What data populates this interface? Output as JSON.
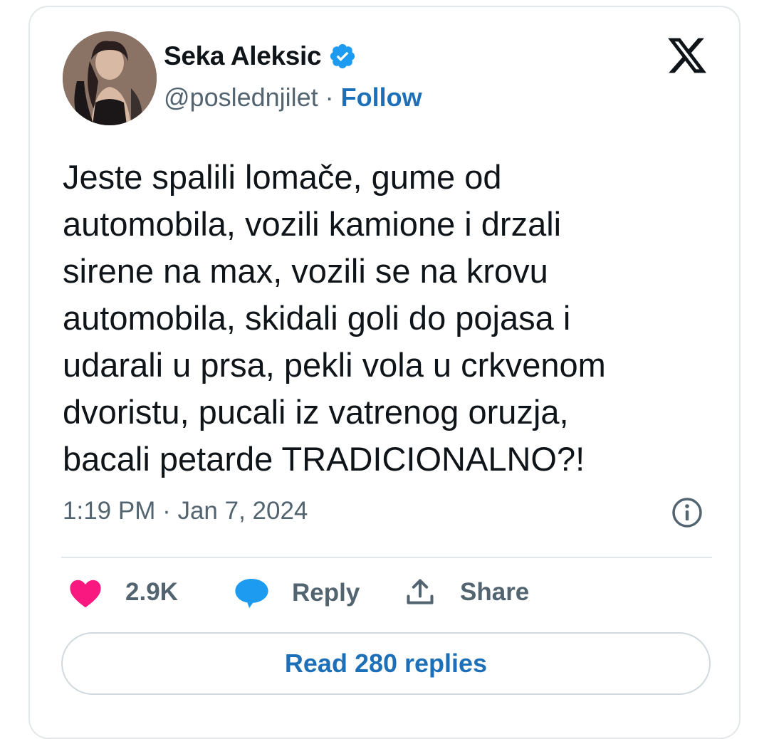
{
  "author": {
    "name": "Seka Aleksic",
    "handle": "@poslednjilet",
    "separator": "·",
    "follow_label": "Follow",
    "verified": true
  },
  "tweet": {
    "text": "Jeste spalili lomače, gume od\nautomobila, vozili kamione i drzali\nsirene na max, vozili se na krovu\nautomobila, skidali goli do pojasa i\nudarali u prsa, pekli vola u crkvenom\ndvoristu, pucali iz vatrenog oruzja,\nbacali petarde TRADICIONALNO?!",
    "timestamp": "1:19 PM · Jan 7, 2024"
  },
  "actions": {
    "like_count": "2.9K",
    "reply_label": "Reply",
    "share_label": "Share"
  },
  "read_replies_label": "Read 280 replies",
  "icons": {
    "verified": "verified-badge-icon",
    "x_logo": "x-logo-icon",
    "info": "info-icon",
    "like": "heart-icon",
    "reply": "speech-bubble-icon",
    "share": "share-icon"
  },
  "colors": {
    "accent": "#1d70b8",
    "verified": "#1d9bf0",
    "like": "#f91880",
    "muted_text": "#536471",
    "text": "#0f1419",
    "border": "#e3e7ea"
  }
}
